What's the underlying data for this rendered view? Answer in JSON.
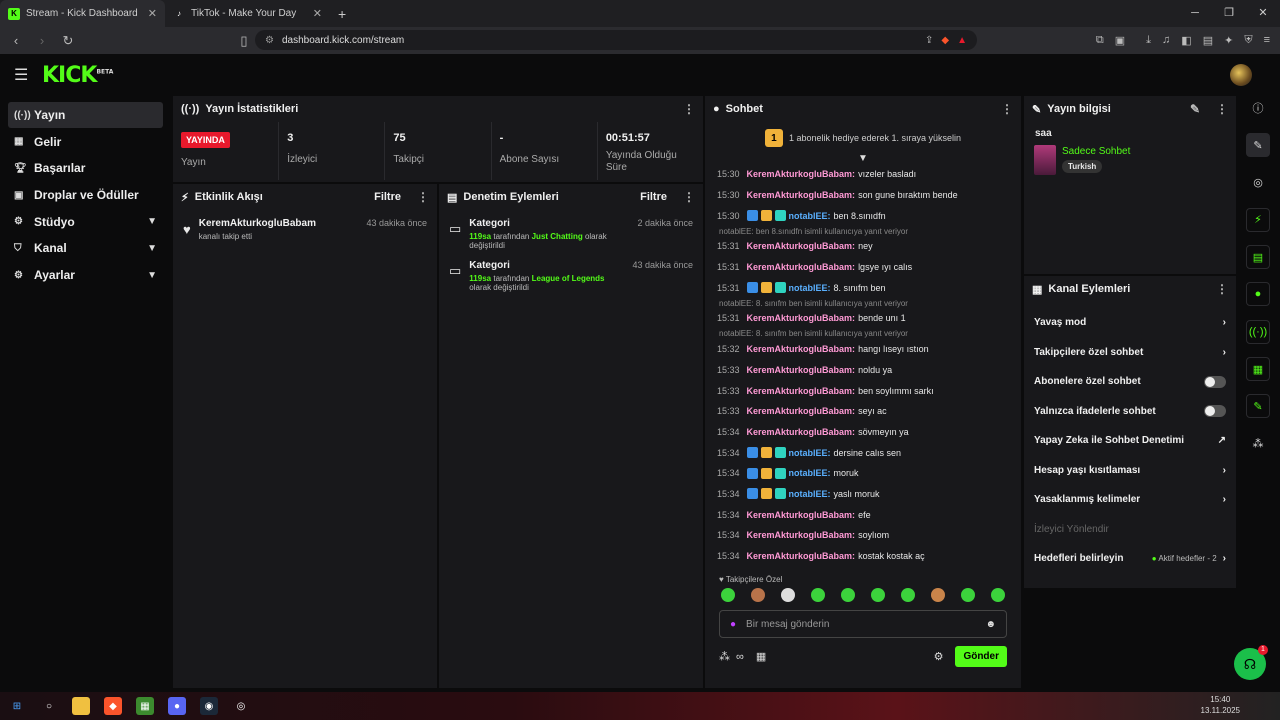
{
  "browser": {
    "tabs": [
      {
        "title": "Stream - Kick Dashboard"
      },
      {
        "title": "TikTok - Make Your Day"
      }
    ],
    "url": "dashboard.kick.com/stream"
  },
  "sidebar": {
    "items": [
      {
        "label": "Yayın",
        "icon": "broadcast-icon"
      },
      {
        "label": "Gelir",
        "icon": "money-icon"
      },
      {
        "label": "Başarılar",
        "icon": "trophy-icon"
      },
      {
        "label": "Droplar ve Ödüller",
        "icon": "gift-icon"
      },
      {
        "label": "Stüdyo",
        "icon": "gear-icon"
      },
      {
        "label": "Kanal",
        "icon": "channel-icon"
      },
      {
        "label": "Ayarlar",
        "icon": "settings-icon"
      }
    ]
  },
  "stats_panel": {
    "title": "Yayın İstatistikleri",
    "live_label": "YAYINDA",
    "items": [
      {
        "value": "",
        "label": "Yayın"
      },
      {
        "value": "3",
        "label": "İzleyici"
      },
      {
        "value": "75",
        "label": "Takipçi"
      },
      {
        "value": "-",
        "label": "Abone Sayısı"
      },
      {
        "value": "00:51:57",
        "label": "Yayında Olduğu Süre"
      }
    ]
  },
  "activity": {
    "title": "Etkinlik Akışı",
    "filter": "Filtre",
    "events": [
      {
        "user": "KeremAkturkogluBabam",
        "text": "kanalı takip etti",
        "time": "43 dakika önce"
      }
    ]
  },
  "moderation": {
    "title": "Denetim Eylemleri",
    "filter": "Filtre",
    "items": [
      {
        "title": "Kategori",
        "by": "119sa",
        "mid": "tarafından",
        "target": "Just Chatting",
        "end": "olarak değiştirildi",
        "time": "2 dakika önce"
      },
      {
        "title": "Kategori",
        "by": "119sa",
        "mid": "tarafından",
        "target": "League of Legends",
        "end": "olarak değiştirildi",
        "time": "43 dakika önce"
      }
    ]
  },
  "chat": {
    "title": "Sohbet",
    "promo": "1 abonelik hediye ederek 1. sıraya yükselin",
    "promo_rank": "1",
    "followers_only": "Takipçilere Özel",
    "input_placeholder": "Bir mesaj gönderin",
    "send": "Gönder",
    "messages": [
      {
        "time": "15:30",
        "user": "KeremAkturkogluBabam:",
        "text": "vızeler basladı",
        "badges": false,
        "reply": ""
      },
      {
        "time": "15:30",
        "user": "KeremAkturkogluBabam:",
        "text": "son gune bıraktım bende",
        "badges": false,
        "reply": ""
      },
      {
        "time": "15:30",
        "user": "notablEE:",
        "text": "ben 8.sınıdfn",
        "badges": true,
        "reply": ""
      },
      {
        "time": "15:31",
        "user": "KeremAkturkogluBabam:",
        "text": "ney",
        "badges": false,
        "reply": "notablEE: ben 8.sınıdfn isimli kullanıcıya yanıt veriyor"
      },
      {
        "time": "15:31",
        "user": "KeremAkturkogluBabam:",
        "text": "lgsye ıyı calıs",
        "badges": false,
        "reply": ""
      },
      {
        "time": "15:31",
        "user": "notablEE:",
        "text": "8. sınıfm ben",
        "badges": true,
        "reply": ""
      },
      {
        "time": "15:31",
        "user": "KeremAkturkogluBabam:",
        "text": "bende unı 1",
        "badges": false,
        "reply": "notablEE: 8. sınıfm ben isimli kullanıcıya yanıt veriyor"
      },
      {
        "time": "15:32",
        "user": "KeremAkturkogluBabam:",
        "text": "hangı lıseyı ıstıon",
        "badges": false,
        "reply": "notablEE: 8. sınıfm ben isimli kullanıcıya yanıt veriyor"
      },
      {
        "time": "15:33",
        "user": "KeremAkturkogluBabam:",
        "text": "noldu ya",
        "badges": false,
        "reply": ""
      },
      {
        "time": "15:33",
        "user": "KeremAkturkogluBabam:",
        "text": "ben soylımmı sarkı",
        "badges": false,
        "reply": ""
      },
      {
        "time": "15:33",
        "user": "KeremAkturkogluBabam:",
        "text": "seyı ac",
        "badges": false,
        "reply": ""
      },
      {
        "time": "15:34",
        "user": "KeremAkturkogluBabam:",
        "text": "sövmeyın ya",
        "badges": false,
        "reply": ""
      },
      {
        "time": "15:34",
        "user": "notablEE:",
        "text": "dersine calıs sen",
        "badges": true,
        "reply": ""
      },
      {
        "time": "15:34",
        "user": "notablEE:",
        "text": "moruk",
        "badges": true,
        "reply": ""
      },
      {
        "time": "15:34",
        "user": "notablEE:",
        "text": "yaslı moruk",
        "badges": true,
        "reply": ""
      },
      {
        "time": "15:34",
        "user": "KeremAkturkogluBabam:",
        "text": "efe",
        "badges": false,
        "reply": ""
      },
      {
        "time": "15:34",
        "user": "KeremAkturkogluBabam:",
        "text": "soylıom",
        "badges": false,
        "reply": ""
      },
      {
        "time": "15:34",
        "user": "KeremAkturkogluBabam:",
        "text": "kostak kostak aç",
        "badges": false,
        "reply": ""
      }
    ]
  },
  "stream_info": {
    "title": "Yayın bilgisi",
    "stream_title": "saa",
    "category": "Sadece Sohbet",
    "tag": "Turkish"
  },
  "channel_actions": {
    "title": "Kanal Eylemleri",
    "items": [
      {
        "label": "Yavaş mod",
        "kind": "chevron"
      },
      {
        "label": "Takipçilere özel sohbet",
        "kind": "chevron"
      },
      {
        "label": "Abonelere özel sohbet",
        "kind": "toggle"
      },
      {
        "label": "Yalnızca ifadelerle sohbet",
        "kind": "toggle"
      },
      {
        "label": "Yapay Zeka ile Sohbet Denetimi",
        "kind": "external"
      },
      {
        "label": "Hesap yaşı kısıtlaması",
        "kind": "chevron"
      },
      {
        "label": "Yasaklanmış kelimeler",
        "kind": "chevron"
      },
      {
        "label": "İzleyici Yönlendir",
        "kind": "disabled"
      },
      {
        "label": "Hedefleri belirleyin",
        "kind": "goals",
        "extra": "Aktif hedefler - 2"
      }
    ]
  },
  "help_badge": "1",
  "clock": {
    "time": "15:40",
    "date": "13.11.2025"
  },
  "colors": {
    "accent": "#53fc18",
    "live": "#e8192c",
    "panel": "#18181b"
  }
}
